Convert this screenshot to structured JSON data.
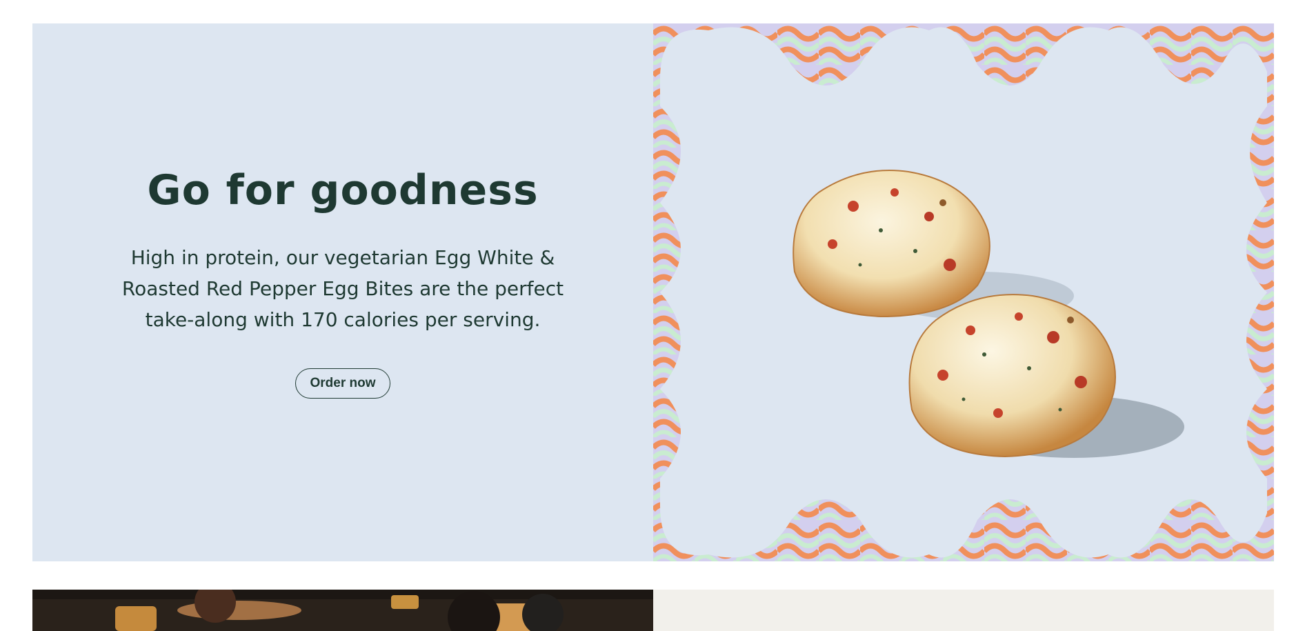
{
  "hero": {
    "headline": "Go for goodness",
    "description": "High in protein, our vegetarian Egg White & Roasted Red Pepper Egg Bites are the perfect take-along with 170 calories per serving.",
    "cta_label": "Order now",
    "image_alt": "Two Egg White & Roasted Red Pepper Egg Bites",
    "colors": {
      "background": "#dde6f1",
      "text": "#1e3932",
      "pattern_orange": "#f0905c",
      "pattern_green": "#c9ecd0",
      "pattern_lavender": "#d3cfee"
    }
  },
  "next_section": {
    "left_image_alt": "People sitting at a cafe table",
    "right_background": "#f2f0eb"
  }
}
